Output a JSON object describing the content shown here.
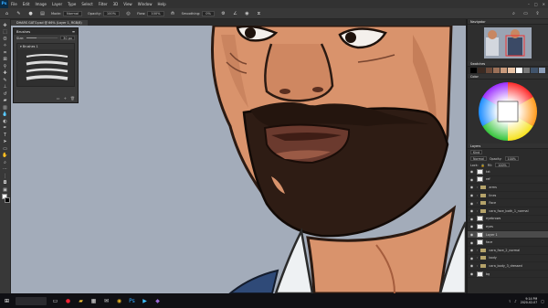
{
  "app": {
    "logo": "Ps",
    "menu": [
      "File",
      "Edit",
      "Image",
      "Layer",
      "Type",
      "Select",
      "Filter",
      "3D",
      "View",
      "Window",
      "Help"
    ],
    "window_controls": [
      "–",
      "□",
      "✕"
    ]
  },
  "options_bar": {
    "mode_label": "Mode:",
    "mode_value": "Normal",
    "opacity_label": "Opacity:",
    "opacity_value": "100%",
    "flow_label": "Flow:",
    "flow_value": "100%",
    "smoothing_label": "Smoothing:",
    "smoothing_value": "0%"
  },
  "document_tab": "DHARS GATO.psd @ 66% (Layer 1, RGB/8)",
  "brushes_panel": {
    "title": "Brushes",
    "size_label": "Size:",
    "size_value": "30 px",
    "size_fraction": 0.3,
    "group_label": "Brushes 1"
  },
  "right_panels": {
    "navigator_tab": "Navigator",
    "swatches_tab": "Swatches",
    "color_tab": "Color",
    "layers_tab": "Layers",
    "layers_filter": "Kind",
    "blend_mode": "Normal",
    "opacity_label": "Opacity:",
    "opacity_value": "100%",
    "lock_label": "Lock:",
    "fill_label": "Fill:",
    "fill_value": "100%",
    "layers": [
      {
        "name": "txt",
        "kind": "layer",
        "selected": false
      },
      {
        "name": "ref",
        "kind": "layer",
        "selected": false
      },
      {
        "name": "arms",
        "kind": "folder",
        "selected": false
      },
      {
        "name": "lines",
        "kind": "folder",
        "selected": false
      },
      {
        "name": "Face",
        "kind": "folder",
        "selected": false
      },
      {
        "name": "cara_face_both_1_normal",
        "kind": "folder",
        "selected": false
      },
      {
        "name": "eyebrows",
        "kind": "layer",
        "selected": false
      },
      {
        "name": "eyes",
        "kind": "layer",
        "selected": false
      },
      {
        "name": "Layer 1",
        "kind": "layer",
        "selected": true
      },
      {
        "name": "face",
        "kind": "layer",
        "selected": false
      },
      {
        "name": "cara_face_2_normal",
        "kind": "folder",
        "selected": false
      },
      {
        "name": "body",
        "kind": "folder",
        "selected": false
      },
      {
        "name": "cara_body_3_dressed",
        "kind": "folder",
        "selected": false
      },
      {
        "name": "bg",
        "kind": "layer",
        "selected": false
      }
    ]
  },
  "swatch_colors": [
    "#000000",
    "#3b2a22",
    "#6b4a3a",
    "#9b7058",
    "#c99a7c",
    "#e8c3a5",
    "#ffffff",
    "#7a7a7a",
    "#40536b",
    "#8a9bb5"
  ],
  "taskbar": {
    "time": "9:14 PM",
    "date": "2020-02-07"
  },
  "colors": {
    "canvas_bg": "#a3acba",
    "skin": "#d9936c",
    "beard": "#2e1c14",
    "lips": "#6b3a2e",
    "shirt": "#eef1f3",
    "accent": "#31a8ff"
  }
}
